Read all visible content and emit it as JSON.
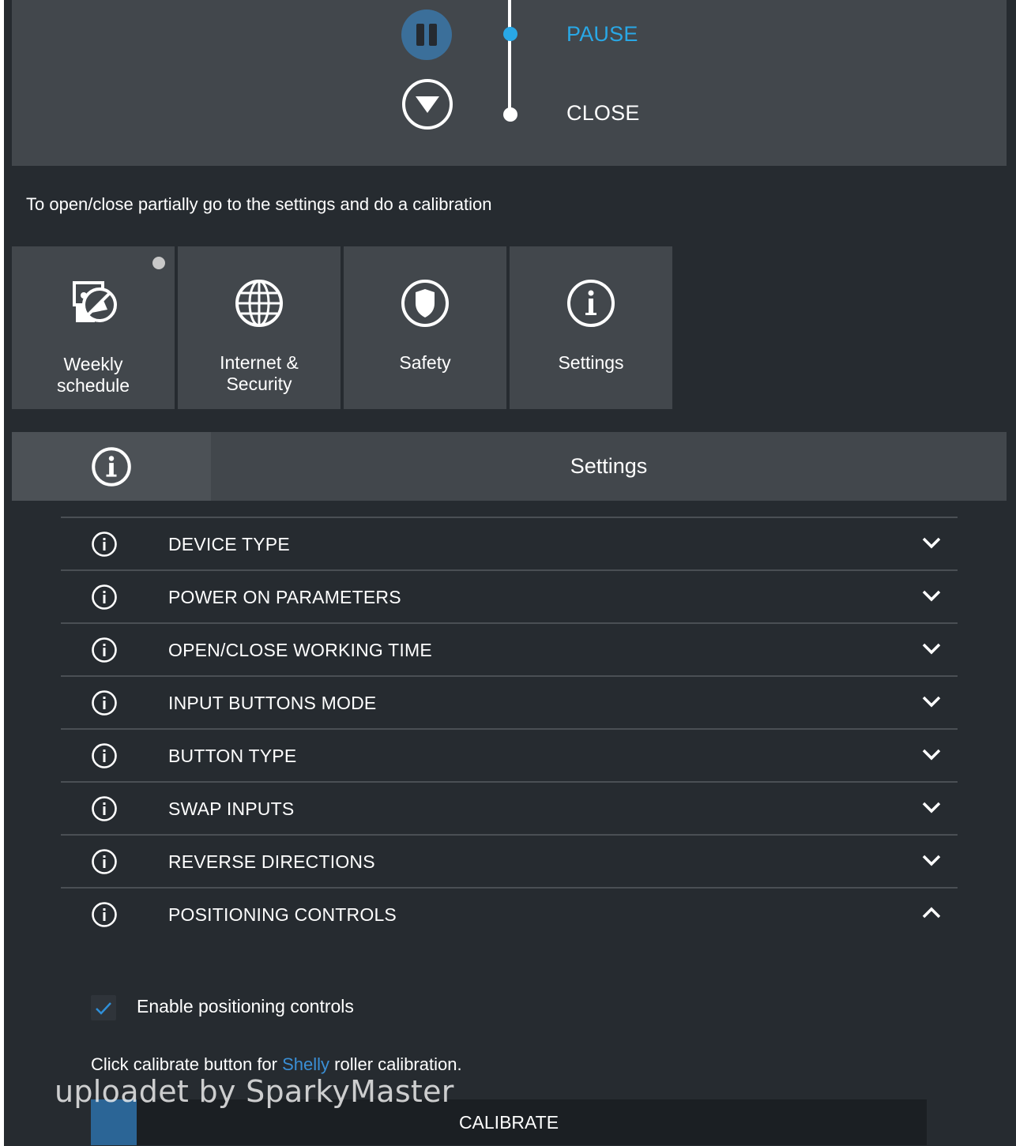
{
  "control": {
    "pause_label": "PAUSE",
    "close_label": "CLOSE",
    "active_color": "#29a8e6"
  },
  "hint": "To open/close partially go to the settings and do a calibration",
  "tiles": [
    {
      "label_line1": "Weekly",
      "label_line2": "schedule",
      "icon": "schedule-icon"
    },
    {
      "label_line1": "Internet &",
      "label_line2": "Security",
      "icon": "globe-icon"
    },
    {
      "label": "Safety",
      "icon": "shield-icon"
    },
    {
      "label": "Settings",
      "icon": "info-icon"
    }
  ],
  "settings_header": {
    "title": "Settings",
    "icon": "info-icon"
  },
  "accordion": {
    "items": [
      {
        "label": "DEVICE TYPE",
        "expanded": false
      },
      {
        "label": "POWER ON PARAMETERS",
        "expanded": false
      },
      {
        "label": "OPEN/CLOSE WORKING TIME",
        "expanded": false
      },
      {
        "label": "INPUT BUTTONS MODE",
        "expanded": false
      },
      {
        "label": "BUTTON TYPE",
        "expanded": false
      },
      {
        "label": "SWAP INPUTS",
        "expanded": false
      },
      {
        "label": "REVERSE DIRECTIONS",
        "expanded": false
      },
      {
        "label": "POSITIONING CONTROLS",
        "expanded": true
      }
    ]
  },
  "positioning": {
    "checkbox_label": "Enable positioning controls",
    "checked": true,
    "cal_text_before": "Click calibrate button for",
    "cal_text_link": "Shelly",
    "cal_text_after": "roller calibration.",
    "calibrate_label": "CALIBRATE"
  },
  "watermark": "uploadet by SparkyMaster"
}
